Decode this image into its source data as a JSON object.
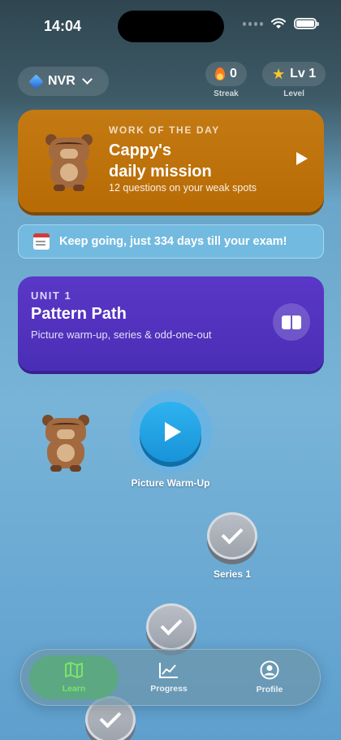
{
  "status_bar": {
    "time": "14:04"
  },
  "header": {
    "subject": "NVR",
    "streak": {
      "value": "0",
      "caption": "Streak"
    },
    "level": {
      "value": "Lv 1",
      "caption": "Level"
    }
  },
  "work_of_day": {
    "eyebrow": "WORK OF THE DAY",
    "title_line1": "Cappy's",
    "title_line2": "daily mission",
    "subtitle": "12 questions on your weak spots"
  },
  "banner": {
    "text": "Keep going, just 334 days till your exam!"
  },
  "unit": {
    "eyebrow": "UNIT 1",
    "title": "Pattern Path",
    "subtitle": "Picture warm-up, series & odd-one-out"
  },
  "path": {
    "nodes": [
      {
        "label": "Picture Warm-Up",
        "state": "current"
      },
      {
        "label": "Series 1",
        "state": "completed"
      },
      {
        "label": "",
        "state": "completed"
      },
      {
        "label": "",
        "state": "completed"
      }
    ]
  },
  "tabs": [
    {
      "label": "Learn",
      "icon": "map-icon",
      "active": true
    },
    {
      "label": "Progress",
      "icon": "chart-icon",
      "active": false
    },
    {
      "label": "Profile",
      "icon": "person-icon",
      "active": false
    }
  ],
  "colors": {
    "work_of_day": "#b86b05",
    "unit": "#4a2eb5",
    "active_node": "#1893d8",
    "active_tab": "#7de36a"
  }
}
